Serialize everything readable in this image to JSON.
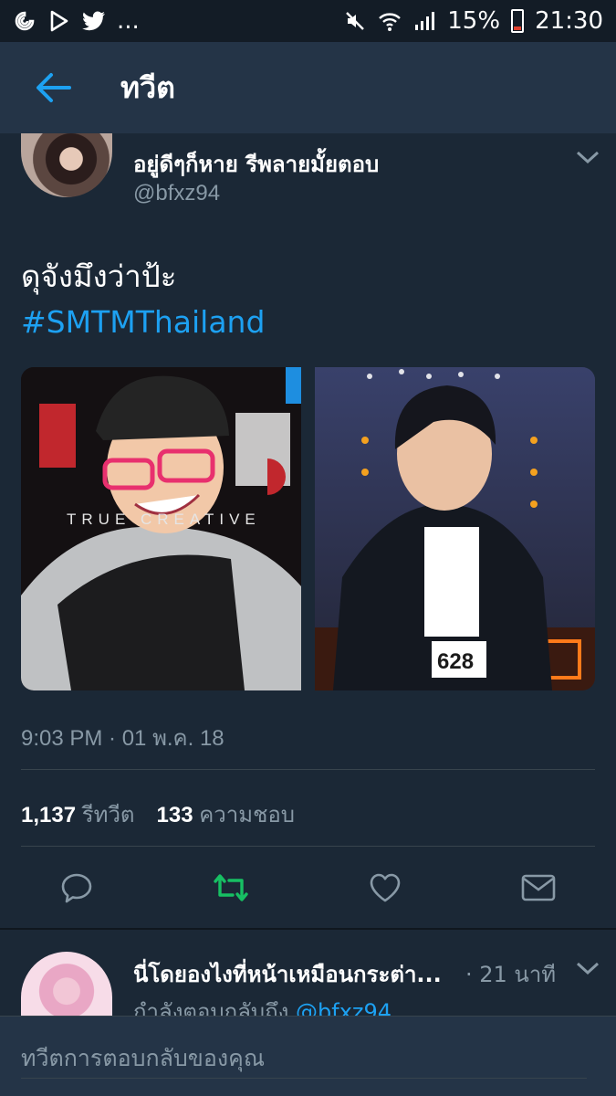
{
  "status_bar": {
    "left_icons": [
      "spiral-notification-icon",
      "play-store-icon",
      "twitter-bird-icon"
    ],
    "more_indicator": "...",
    "battery_percent": "15%",
    "time": "21:30",
    "battery_level": 0.15
  },
  "app_bar": {
    "title": "ทวีต"
  },
  "tweet": {
    "author_name": "อยู่ดีๆก็หาย รีพลายมั้ยตอบ",
    "author_handle": "@bfxz94",
    "text": "ดุจังมึงว่าป้ะ",
    "hashtag": "#SMTMThailand",
    "timestamp": "9:03 PM · 01 พ.ค. 18",
    "retweet_count": "1,137",
    "retweet_label": "รีทวีต",
    "like_count": "133",
    "like_label": "ความชอบ",
    "media": {
      "left_photo_text": "TRUE CREATIVE",
      "right_photo_text": "628"
    }
  },
  "reply": {
    "author_name": "นี่โดยองไงที่หน้าเหมือนกระต่า...",
    "time": "· 21 นาที",
    "replying_to_prefix": "กำลังตอบกลับถึง",
    "replying_to_handle": "@bfxz94"
  },
  "compose": {
    "placeholder": "ทวีตการตอบกลับของคุณ"
  },
  "colors": {
    "background": "#1b2836",
    "app_bar": "#243447",
    "accent": "#1da1f2",
    "retweet_active": "#17bf63",
    "secondary_text": "#8899a6"
  }
}
